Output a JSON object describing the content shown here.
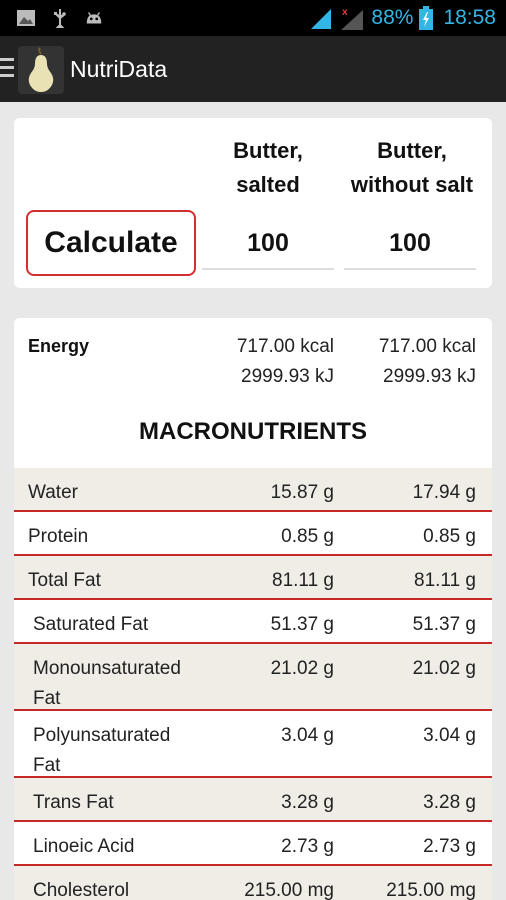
{
  "status_bar": {
    "left_icons": [
      "image-icon",
      "usb-icon",
      "android-icon"
    ],
    "battery_text": "88%",
    "time": "18:58"
  },
  "action_bar": {
    "title": "NutriData"
  },
  "compare": {
    "calculate_label": "Calculate",
    "columns": [
      {
        "name_line1": "Butter,",
        "name_line2": "salted",
        "quantity": "100"
      },
      {
        "name_line1": "Butter,",
        "name_line2": "without salt",
        "quantity": "100"
      }
    ]
  },
  "energy": {
    "label": "Energy",
    "values": [
      {
        "kcal": "717.00 kcal",
        "kj": "2999.93 kJ"
      },
      {
        "kcal": "717.00 kcal",
        "kj": "2999.93 kJ"
      }
    ]
  },
  "macronutrients": {
    "title": "MACRONUTRIENTS",
    "rows": [
      {
        "label": "Water",
        "v1": "15.87 g",
        "v2": "17.94 g"
      },
      {
        "label": "Protein",
        "v1": "0.85 g",
        "v2": "0.85 g"
      },
      {
        "label": "Total Fat",
        "v1": "81.11 g",
        "v2": "81.11 g"
      },
      {
        "label": "Saturated Fat",
        "v1": "51.37 g",
        "v2": "51.37 g"
      },
      {
        "label": "Monounsaturated Fat",
        "v1": "21.02 g",
        "v2": "21.02 g"
      },
      {
        "label": "Polyunsaturated Fat",
        "v1": "3.04 g",
        "v2": "3.04 g"
      },
      {
        "label": "Trans Fat",
        "v1": "3.28 g",
        "v2": "3.28 g"
      },
      {
        "label": "Linoeic Acid",
        "v1": "2.73 g",
        "v2": "2.73 g"
      },
      {
        "label": "Cholesterol",
        "v1": "215.00 mg",
        "v2": "215.00 mg"
      }
    ]
  },
  "colors": {
    "accent_red": "#c62828",
    "status_blue": "#33b5e5",
    "row_shade": "#efede6"
  }
}
